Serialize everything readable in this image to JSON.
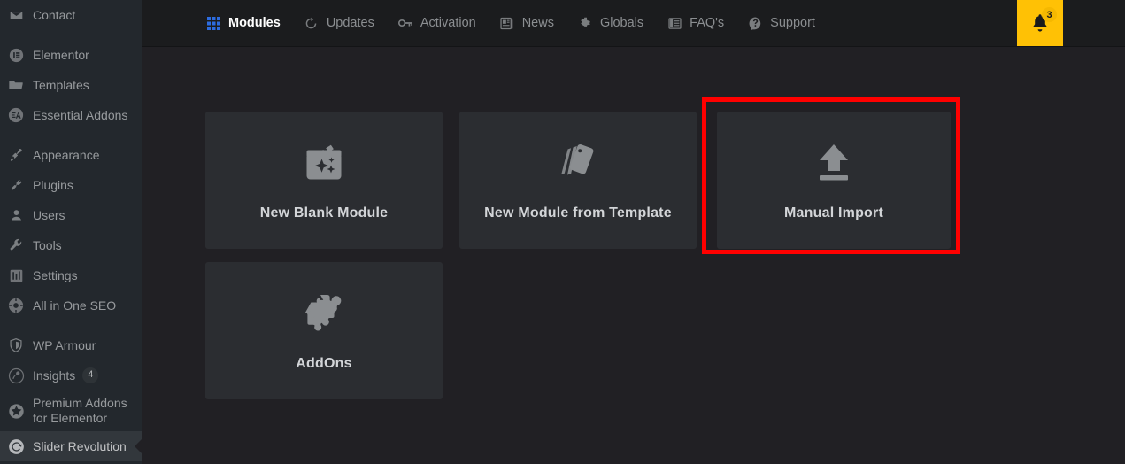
{
  "sidebar": {
    "items": [
      {
        "label": "Contact",
        "icon": "mail-icon",
        "gap_after": true,
        "active": false
      },
      {
        "label": "Elementor",
        "icon": "elementor-icon",
        "gap_after": false,
        "active": false
      },
      {
        "label": "Templates",
        "icon": "folder-icon",
        "gap_after": false,
        "active": false
      },
      {
        "label": "Essential Addons",
        "icon": "essential-addons-icon",
        "gap_after": true,
        "active": false
      },
      {
        "label": "Appearance",
        "icon": "paintbrush-icon",
        "gap_after": false,
        "active": false
      },
      {
        "label": "Plugins",
        "icon": "plug-icon",
        "gap_after": false,
        "active": false
      },
      {
        "label": "Users",
        "icon": "user-icon",
        "gap_after": false,
        "active": false
      },
      {
        "label": "Tools",
        "icon": "wrench-icon",
        "gap_after": false,
        "active": false
      },
      {
        "label": "Settings",
        "icon": "sliders-icon",
        "gap_after": false,
        "active": false
      },
      {
        "label": "All in One SEO",
        "icon": "aioseo-icon",
        "gap_after": true,
        "active": false
      },
      {
        "label": "WP Armour",
        "icon": "shield-icon",
        "gap_after": false,
        "active": false
      },
      {
        "label": "Insights",
        "icon": "insights-icon",
        "badge": "4",
        "gap_after": false,
        "active": false
      },
      {
        "label": "Premium Addons for Elementor",
        "icon": "star-badge-icon",
        "two_line": true,
        "gap_after": false,
        "active": false
      },
      {
        "label": "Slider Revolution",
        "icon": "slider-revolution-icon",
        "gap_after": false,
        "active": true
      }
    ]
  },
  "topnav": {
    "items": [
      {
        "label": "Modules",
        "icon": "grid-icon",
        "active": true
      },
      {
        "label": "Updates",
        "icon": "refresh-icon",
        "active": false
      },
      {
        "label": "Activation",
        "icon": "key-icon",
        "active": false
      },
      {
        "label": "News",
        "icon": "newspaper-icon",
        "active": false
      },
      {
        "label": "Globals",
        "icon": "gear-icon",
        "active": false
      },
      {
        "label": "FAQ's",
        "icon": "book-icon",
        "active": false
      },
      {
        "label": "Support",
        "icon": "question-icon",
        "active": false
      }
    ],
    "notifications": {
      "icon": "bell-icon",
      "count": "3",
      "background_color": "#ffc105"
    }
  },
  "content": {
    "cards": [
      {
        "label": "New Blank Module",
        "icon": "film-slate-sparkle-icon",
        "highlighted": false
      },
      {
        "label": "New Module from Template",
        "icon": "template-cards-icon",
        "highlighted": false
      },
      {
        "label": "Manual Import",
        "icon": "upload-icon",
        "highlighted": true
      },
      {
        "label": "AddOns",
        "icon": "puzzle-piece-icon",
        "highlighted": false
      }
    ]
  },
  "theme": {
    "page_background": "#212024",
    "card_background": "#2b2d31",
    "sidebar_background": "#23282d",
    "topnav_background": "#1b1c1e",
    "accent_blue": "#2d6cdf",
    "highlight_red": "#ff0000",
    "notify_yellow": "#ffc105"
  }
}
